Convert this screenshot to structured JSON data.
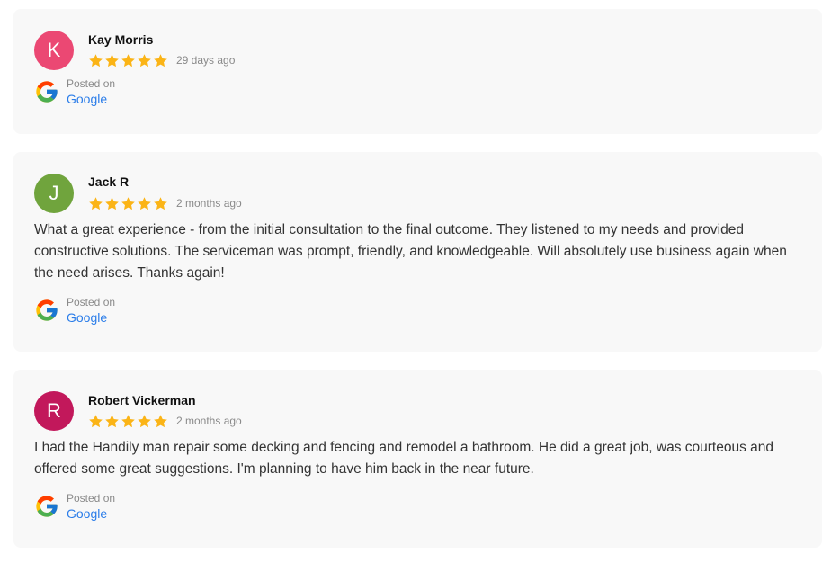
{
  "theme": {
    "star_color": "#fbb416",
    "link_color": "#2b7de9"
  },
  "reviews": [
    {
      "initial": "K",
      "avatar_color": "#eb4873",
      "name": "Kay Morris",
      "rating": 5,
      "date": "29 days ago",
      "text": "",
      "posted_label": "Posted on",
      "source": "Google",
      "source_icon": "google-g-icon"
    },
    {
      "initial": "J",
      "avatar_color": "#70a43d",
      "name": "Jack R",
      "rating": 5,
      "date": "2 months ago",
      "text": "What a great experience - from the initial consultation to the final outcome. They listened to my needs and provided constructive solutions. The serviceman was prompt, friendly, and knowledgeable. Will absolutely use business again when the need arises. Thanks again!",
      "posted_label": "Posted on",
      "source": "Google",
      "source_icon": "google-g-icon"
    },
    {
      "initial": "R",
      "avatar_color": "#c2185b",
      "name": "Robert Vickerman",
      "rating": 5,
      "date": "2 months ago",
      "text": "I had the Handily man repair some decking and fencing and remodel a bathroom. He did a great job, was courteous and offered some great suggestions. I'm planning to have him back in the near future.",
      "posted_label": "Posted on",
      "source": "Google",
      "source_icon": "google-g-icon"
    }
  ]
}
